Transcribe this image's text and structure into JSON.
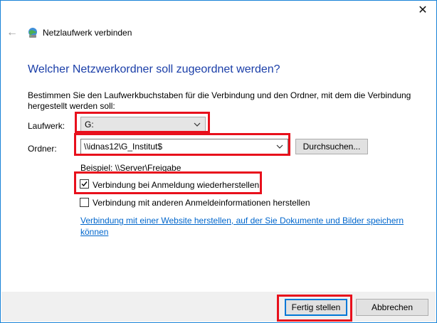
{
  "window": {
    "title": "Netzlaufwerk verbinden",
    "close_glyph": "✕",
    "back_glyph": "←"
  },
  "main": {
    "heading": "Welcher Netzwerkordner soll zugeordnet werden?",
    "description": "Bestimmen Sie den Laufwerkbuchstaben für die Verbindung und den Ordner, mit dem die Verbindung hergestellt werden soll:",
    "drive_label": "Laufwerk:",
    "drive_value": "G:",
    "folder_label": "Ordner:",
    "folder_value": "\\\\idnas12\\G_Institut$",
    "browse_label": "Durchsuchen...",
    "example": "Beispiel: \\\\Server\\Freigabe",
    "reconnect_label": "Verbindung bei Anmeldung wiederherstellen",
    "reconnect_checked": true,
    "other_creds_label": "Verbindung mit anderen Anmeldeinformationen herstellen",
    "other_creds_checked": false,
    "website_link": "Verbindung mit einer Website herstellen, auf der Sie Dokumente und Bilder speichern können"
  },
  "footer": {
    "finish_label": "Fertig stellen",
    "cancel_label": "Abbrechen"
  },
  "colors": {
    "accent": "#0078d7",
    "heading": "#1a3ea8",
    "highlight": "#e8101c",
    "link": "#0066cc"
  }
}
